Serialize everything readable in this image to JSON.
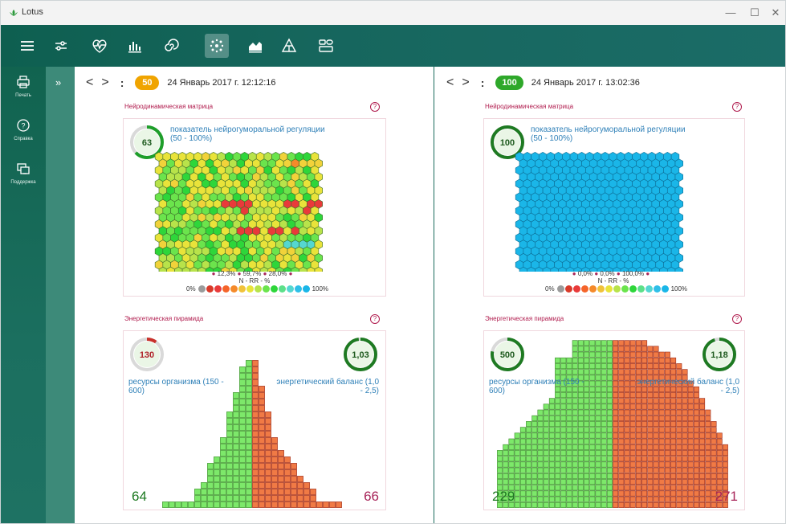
{
  "app": {
    "title": "Lotus"
  },
  "window_controls": {
    "minimize": "—",
    "maximize": "☐",
    "close": "✕"
  },
  "toolbar": {
    "icons": [
      "menu-icon",
      "sliders-icon",
      "heart-monitor-icon",
      "bar-chart-icon",
      "spiral-icon",
      "matrix-icon",
      "area-chart-icon",
      "pyramid-icon",
      "layout-icon"
    ],
    "active_index": 5
  },
  "rail": {
    "items": [
      {
        "label": "Печать",
        "icon": "printer-icon"
      },
      {
        "label": "Справка",
        "icon": "help-icon"
      },
      {
        "label": "Поддержка",
        "icon": "monitor-icon"
      }
    ]
  },
  "collapse": {
    "label": "»"
  },
  "panes": [
    {
      "nav": {
        "prev": "<",
        "next": ">",
        "more": ":",
        "score": "50",
        "score_color": "#f0a400",
        "date": "24 Январь 2017 г. 12:12:16"
      },
      "matrix": {
        "title": "Нейродинамическая матрица",
        "help": "?",
        "gauge_value": "63",
        "gauge_fraction": 0.63,
        "gauge_color": "#1e9e2a",
        "label": "показатель нейрогуморальной регуляции (50 - 100%)",
        "pcts": [
          "12,3%",
          "59,7%",
          "28,0%"
        ],
        "scale_unit": "N - RR - %",
        "scale_min": "0%",
        "scale_max": "100%",
        "mode": "mixed"
      },
      "pyramid": {
        "title": "Энергетическая пирамида",
        "help": "?",
        "left_value": "130",
        "left_fraction": 0.1,
        "left_color": "#c8302a",
        "left_label": "ресурсы организма (150 - 600)",
        "right_value": "1,03",
        "right_fraction": 0.98,
        "right_color": "#1e7a22",
        "right_label": "энергетический баланс (1,0 - 2,5)",
        "bottom_left": "64",
        "bottom_right": "66",
        "bottom_right_color": "#a8265a",
        "green_cols": [
          1,
          1,
          1,
          1,
          1,
          3,
          4,
          7,
          8,
          11,
          15,
          18,
          22,
          23
        ],
        "red_cols": [
          23,
          19,
          15,
          11,
          9,
          8,
          7,
          5,
          4,
          3,
          1,
          1,
          1,
          1
        ]
      }
    },
    {
      "nav": {
        "prev": "<",
        "next": ">",
        "more": ":",
        "score": "100",
        "score_color": "#2ea82a",
        "date": "24 Январь 2017 г. 13:02:36"
      },
      "matrix": {
        "title": "Нейродинамическая матрица",
        "help": "?",
        "gauge_value": "100",
        "gauge_fraction": 1.0,
        "gauge_color": "#1e7a22",
        "label": "показатель нейрогуморальной регуляции (50 - 100%)",
        "pcts": [
          "0,0%",
          "0,0%",
          "100,0%"
        ],
        "scale_unit": "N - RR - %",
        "scale_min": "0%",
        "scale_max": "100%",
        "mode": "blue"
      },
      "pyramid": {
        "title": "Энергетическая пирамида",
        "help": "?",
        "left_value": "500",
        "left_fraction": 0.78,
        "left_color": "#1e7a22",
        "left_label": "ресурсы организма (150 - 600)",
        "right_value": "1,18",
        "right_fraction": 0.95,
        "right_color": "#1e7a22",
        "right_label": "энергетический баланс (1,0 - 2,5)",
        "bottom_left": "229",
        "bottom_right": "271",
        "bottom_right_color": "#a8265a",
        "green_cols": [
          10,
          11,
          12,
          13,
          14,
          15,
          16,
          17,
          18,
          19,
          26,
          26,
          26,
          29,
          29,
          29,
          29,
          29,
          29,
          29
        ],
        "red_cols": [
          29,
          29,
          29,
          29,
          29,
          29,
          28,
          28,
          27,
          27,
          26,
          25,
          24,
          22,
          21,
          19,
          17,
          15,
          13,
          11
        ]
      }
    }
  ],
  "colors": {
    "accent_dark": "#11634f",
    "hex_blue": "#1ab6e8",
    "pyr_green": "#7de86a",
    "pyr_red": "#f07a45"
  }
}
